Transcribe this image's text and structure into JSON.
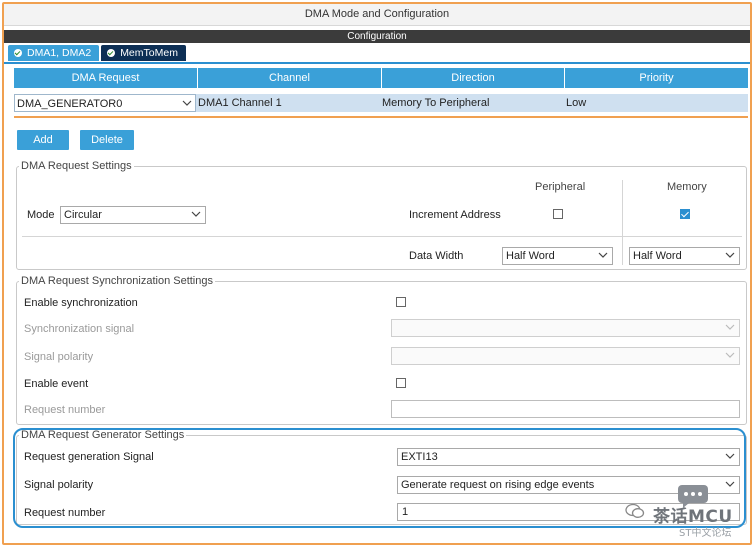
{
  "window": {
    "title": "DMA Mode and Configuration",
    "section": "Configuration"
  },
  "tabs": [
    {
      "label": "DMA1, DMA2",
      "active": false
    },
    {
      "label": "MemToMem",
      "active": true
    }
  ],
  "table": {
    "headers": [
      "DMA Request",
      "Channel",
      "Direction",
      "Priority"
    ],
    "rows": [
      {
        "request": "DMA_GENERATOR0",
        "channel": "DMA1 Channel 1",
        "direction": "Memory To Peripheral",
        "priority": "Low"
      }
    ]
  },
  "buttons": {
    "add": "Add",
    "delete": "Delete"
  },
  "request_settings": {
    "legend": "DMA Request Settings",
    "col_peripheral": "Peripheral",
    "col_memory": "Memory",
    "mode_label": "Mode",
    "mode_value": "Circular",
    "increment_label": "Increment Address",
    "increment_peripheral": false,
    "increment_memory": true,
    "data_width_label": "Data Width",
    "data_width_peripheral": "Half Word",
    "data_width_memory": "Half Word"
  },
  "sync_settings": {
    "legend": "DMA Request Synchronization Settings",
    "enable_sync_label": "Enable synchronization",
    "sync_signal_label": "Synchronization signal",
    "signal_polarity_label": "Signal polarity",
    "enable_event_label": "Enable event",
    "request_number_label": "Request number"
  },
  "generator_settings": {
    "legend": "DMA Request Generator Settings",
    "gen_signal_label": "Request generation Signal",
    "gen_signal_value": "EXTI13",
    "polarity_label": "Signal polarity",
    "polarity_value": "Generate request on rising edge events",
    "request_number_label": "Request number",
    "request_number_value": "1"
  },
  "watermark": {
    "name": "茶话MCU",
    "sub": "ST中文论坛"
  },
  "colors": {
    "accent": "#3aa0d8",
    "dark_tab": "#0d2f55",
    "highlight": "#f0a050",
    "outline": "#2b8fd0"
  }
}
